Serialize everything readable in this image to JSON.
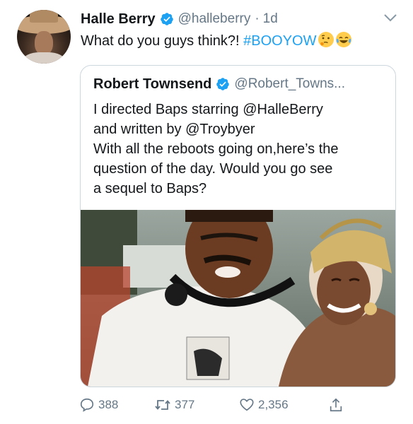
{
  "tweet": {
    "display_name": "Halle Berry",
    "handle": "@halleberry",
    "separator": "·",
    "time": "1d",
    "text_prefix": "What do you guys think?! ",
    "hashtag": "#BOOYOW",
    "emojis": [
      "thinking-face-emoji",
      "tears-of-joy-emoji"
    ]
  },
  "quoted_tweet": {
    "display_name": "Robert Townsend",
    "handle": "@Robert_Towns...",
    "lines": [
      "I directed Baps starring @HalleBerry",
      "and written by @Troybyer",
      "With all the reboots going on,here’s the",
      "question of the day. Would you go see",
      "a sequel to Baps?"
    ]
  },
  "actions": {
    "reply_count": "388",
    "retweet_count": "377",
    "like_count": "2,356"
  },
  "colors": {
    "text": "#14171a",
    "secondary": "#657786",
    "accent": "#1da1f2",
    "border": "#ccd6dd"
  },
  "icons": [
    "verified-badge-icon",
    "chevron-down-icon",
    "reply-icon",
    "retweet-icon",
    "heart-icon",
    "share-icon"
  ]
}
